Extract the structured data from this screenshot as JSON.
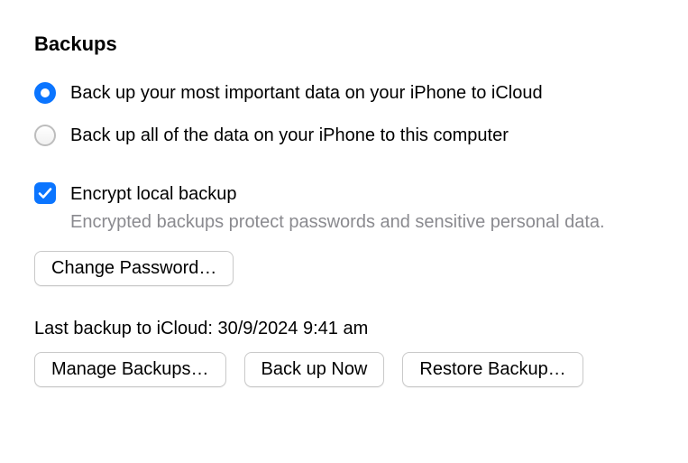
{
  "heading": "Backups",
  "options": {
    "icloud": {
      "label": "Back up your most important data on your iPhone to iCloud",
      "selected": true
    },
    "local": {
      "label": "Back up all of the data on your iPhone to this computer",
      "selected": false
    }
  },
  "encrypt": {
    "label": "Encrypt local backup",
    "description": "Encrypted backups protect passwords and sensitive personal data.",
    "checked": true
  },
  "buttons": {
    "change_password": "Change Password…",
    "manage_backups": "Manage Backups…",
    "back_up_now": "Back up Now",
    "restore_backup": "Restore Backup…"
  },
  "last_backup_text": "Last backup to iCloud: 30/9/2024 9:41 am"
}
